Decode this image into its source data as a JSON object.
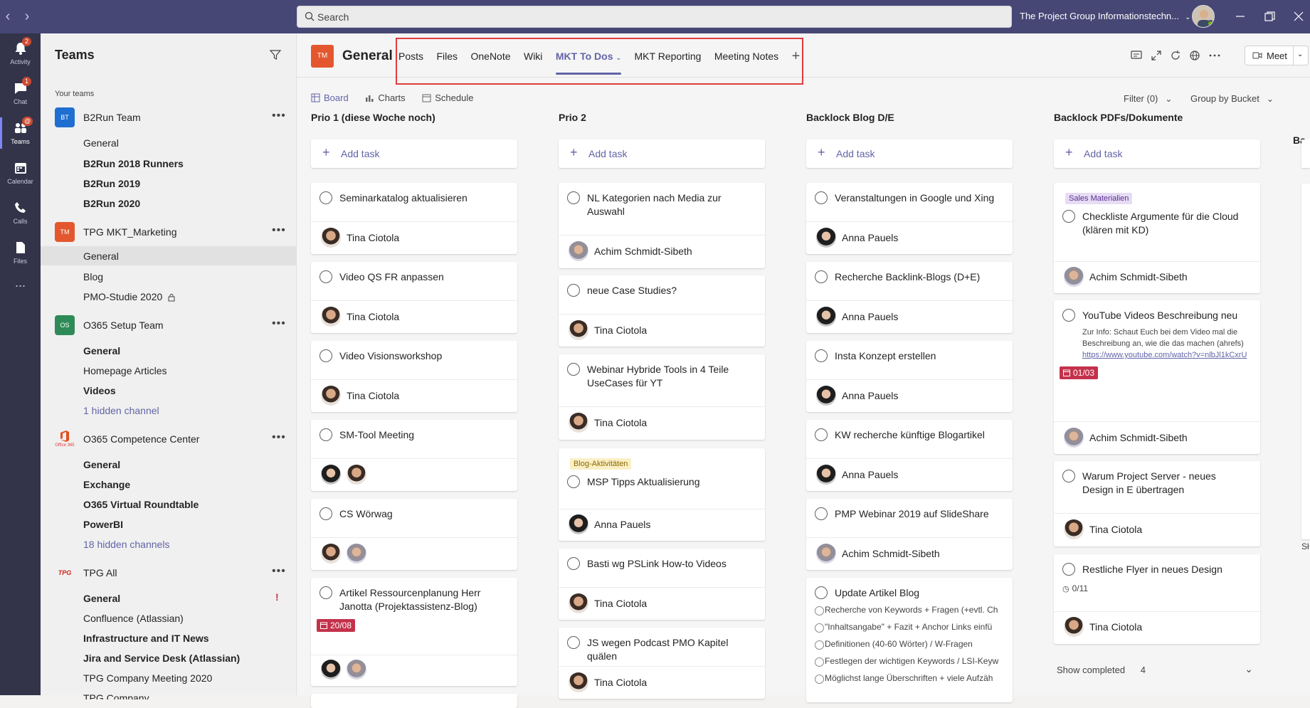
{
  "topbar": {
    "search_placeholder": "Search",
    "org_name": "The Project Group Informationstechn...",
    "colors": {
      "bar": "#464775",
      "rail": "#33344a",
      "accent": "#6264a7",
      "red_highlight": "#e03c3c"
    }
  },
  "rail": {
    "items": [
      {
        "label": "Activity",
        "icon": "bell-icon",
        "badge": "2"
      },
      {
        "label": "Chat",
        "icon": "chat-icon",
        "badge": "1"
      },
      {
        "label": "Teams",
        "icon": "teams-icon",
        "badge": "@"
      },
      {
        "label": "Calendar",
        "icon": "calendar-icon"
      },
      {
        "label": "Calls",
        "icon": "phone-icon"
      },
      {
        "label": "Files",
        "icon": "file-icon"
      }
    ],
    "more": "..."
  },
  "teams_panel": {
    "title": "Teams",
    "section_label": "Your teams",
    "teams": [
      {
        "initials": "BT",
        "name": "B2Run Team",
        "channels": [
          "General",
          "B2Run 2018 Runners",
          "B2Run 2019",
          "B2Run 2020"
        ]
      },
      {
        "initials": "TM",
        "name": "TPG MKT_Marketing",
        "channels": [
          "General",
          "Blog",
          "PMO-Studie 2020"
        ]
      },
      {
        "initials": "OS",
        "name": "O365 Setup Team",
        "channels": [
          "General",
          "Homepage Articles",
          "Videos",
          "1 hidden channel"
        ]
      },
      {
        "initials": "Office 365",
        "name": "O365 Competence Center",
        "channels": [
          "General",
          "Exchange",
          "O365 Virtual Roundtable",
          "PowerBI",
          "18 hidden channels"
        ]
      },
      {
        "initials": "TPG",
        "name": "TPG All",
        "channels": [
          "General",
          "Confluence (Atlassian)",
          "Infrastructure and IT News",
          "Jira and Service Desk (Atlassian)",
          "TPG Company Meeting 2020",
          "TPG Company"
        ]
      }
    ],
    "alert": "!"
  },
  "channel": {
    "avatar": "TM",
    "name": "General",
    "tabs": [
      "Posts",
      "Files",
      "OneNote",
      "Wiki",
      "MKT To Dos",
      "MKT Reporting",
      "Meeting Notes"
    ],
    "tab_add": "+",
    "meet": "Meet"
  },
  "planner": {
    "views": [
      "Board",
      "Charts",
      "Schedule"
    ],
    "filter": "Filter (0)",
    "group_by": "Group by Bucket",
    "add_task": "Add task",
    "buckets": [
      {
        "name": "Prio 1 (diese Woche noch)",
        "tasks": [
          {
            "title": "Seminarkatalog aktualisieren",
            "assignees": [
              "Tina Ciotola"
            ]
          },
          {
            "title": "Video QS FR anpassen",
            "assignees": [
              "Tina Ciotola"
            ]
          },
          {
            "title": "Video Visionsworkshop",
            "assignees": [
              "Tina Ciotola"
            ]
          },
          {
            "title": "SM-Tool Meeting",
            "assignees": [
              "anna",
              "tina"
            ]
          },
          {
            "title": "CS Wörwag",
            "assignees": [
              "tina",
              "achim"
            ]
          },
          {
            "title": "Artikel Ressourcenplanung Herr Janotta (Projektassistenz-Blog)",
            "due": "20/08",
            "assignees": [
              "anna",
              "achim"
            ]
          }
        ]
      },
      {
        "name": "Prio 2",
        "tasks": [
          {
            "title": "NL Kategorien nach Media zur Auswahl",
            "assignees": [
              "Achim Schmidt-Sibeth"
            ]
          },
          {
            "title": "neue Case Studies?",
            "assignees": [
              "Tina Ciotola"
            ]
          },
          {
            "title": "Webinar Hybride Tools in 4 Teile UseCases für YT",
            "assignees": [
              "Tina Ciotola"
            ]
          },
          {
            "label": "Blog-Aktivitäten",
            "title": "MSP Tipps Aktualisierung",
            "assignees": [
              "Anna Pauels"
            ]
          },
          {
            "title": "Basti wg PSLink How-to Videos",
            "assignees": [
              "Tina Ciotola"
            ]
          },
          {
            "title": "JS wegen Podcast PMO Kapitel quälen",
            "assignees": [
              "Tina Ciotola"
            ]
          }
        ]
      },
      {
        "name": "Backlock Blog D/E",
        "tasks": [
          {
            "title": "Veranstaltungen in Google und Xing",
            "assignees": [
              "Anna Pauels"
            ]
          },
          {
            "title": "Recherche Backlink-Blogs (D+E)",
            "assignees": [
              "Anna Pauels"
            ]
          },
          {
            "title": "Insta Konzept erstellen",
            "assignees": [
              "Anna Pauels"
            ]
          },
          {
            "title": "KW recherche künftige Blogartikel",
            "assignees": [
              "Anna Pauels"
            ]
          },
          {
            "title": "PMP Webinar 2019 auf SlideShare",
            "assignees": [
              "Achim Schmidt-Sibeth"
            ]
          },
          {
            "title": "Update Artikel Blog",
            "checklist": [
              "Recherche von Keywords + Fragen (+evtl. Ch",
              "\"Inhaltsangabe\" + Fazit + Anchor Links einfü",
              "Definitionen (40-60 Wörter) / W-Fragen",
              "Festlegen der wichtigen Keywords / LSI-Keyw",
              "Möglichst lange Überschriften + viele Aufzäh"
            ]
          }
        ]
      },
      {
        "name": "Backlock PDFs/Dokumente",
        "tasks": [
          {
            "label": "Sales Materialien",
            "title": "Checkliste Argumente für die Cloud (klären mit KD)",
            "assignees": [
              "Achim Schmidt-Sibeth"
            ]
          },
          {
            "title": "YouTube Videos Beschreibung neu",
            "note": "Zur Info: Schaut Euch bei dem Video mal die Beschreibung an, wie die das machen (ahrefs)",
            "link": "https://www.youtube.com/watch?v=nlbJl1kCxrU",
            "due": "01/03",
            "assignees": [
              "Achim Schmidt-Sibeth"
            ]
          },
          {
            "title": "Warum Project Server - neues Design in E übertragen",
            "assignees": [
              "Tina Ciotola"
            ]
          },
          {
            "title": "Restliche Flyer in neues Design",
            "checklist_count": "0/11",
            "assignees": [
              "Tina Ciotola"
            ]
          }
        ],
        "show_completed": "Show completed",
        "completed_count": "4"
      },
      {
        "name": "Ba"
      }
    ],
    "edge_text": "Sł"
  }
}
